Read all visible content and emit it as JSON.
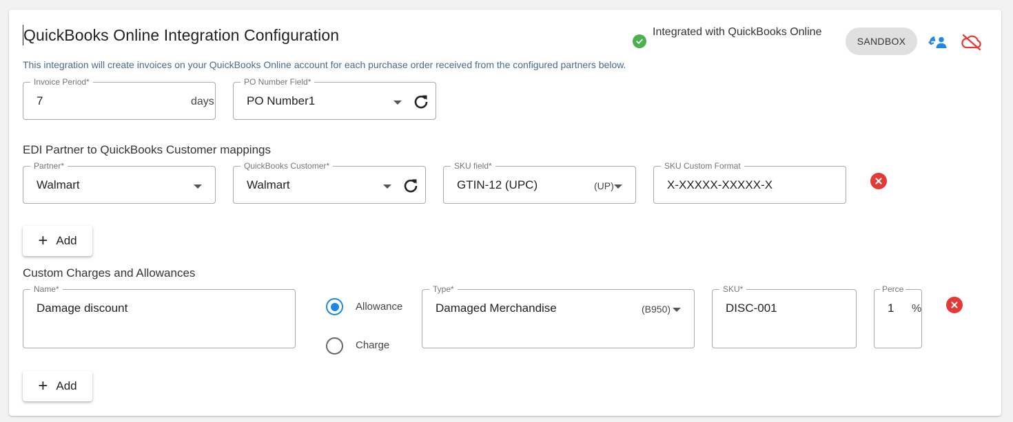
{
  "header": {
    "title": "QuickBooks Online Integration Configuration",
    "subtitle": "This integration will create invoices on your QuickBooks Online account for each purchase order received from the configured partners below.",
    "status_text": "Integrated with QuickBooks Online",
    "environment_chip": "SANDBOX",
    "status_color": "#4caf50",
    "accent_color": "#1e88e5",
    "danger_color": "#e53935"
  },
  "settings": {
    "invoice_period": {
      "label": "Invoice Period*",
      "value": "7",
      "suffix": "days"
    },
    "po_number_field": {
      "label": "PO Number Field*",
      "value": "PO Number1"
    }
  },
  "partner_mappings": {
    "heading": "EDI Partner to QuickBooks Customer mappings",
    "rows": [
      {
        "partner": {
          "label": "Partner*",
          "value": "Walmart"
        },
        "customer": {
          "label": "QuickBooks Customer*",
          "value": "Walmart"
        },
        "sku_field": {
          "label": "SKU field*",
          "value": "GTIN-12 (UPC)",
          "code": "(UP)"
        },
        "sku_format": {
          "label": "SKU Custom Format",
          "value": "X-XXXXX-XXXXX-X"
        }
      }
    ],
    "add_label": "Add"
  },
  "charges": {
    "heading": "Custom Charges and Allowances",
    "rows": [
      {
        "name": {
          "label": "Name*",
          "value": "Damage discount"
        },
        "kind_options": [
          "Allowance",
          "Charge"
        ],
        "kind_selected": "Allowance",
        "type": {
          "label": "Type*",
          "value": "Damaged Merchandise",
          "code": "(B950)"
        },
        "sku": {
          "label": "SKU*",
          "value": "DISC-001"
        },
        "percent": {
          "label": "Perce",
          "value": "1",
          "suffix": "%"
        }
      }
    ],
    "add_label": "Add"
  },
  "icons": {
    "status": "check-circle-icon",
    "sync": "sync-account-icon",
    "disconnect": "cloud-off-icon",
    "refresh": "refresh-icon",
    "remove": "cancel-circle-icon",
    "dropdown": "dropdown-arrow-icon",
    "add": "plus-icon"
  }
}
